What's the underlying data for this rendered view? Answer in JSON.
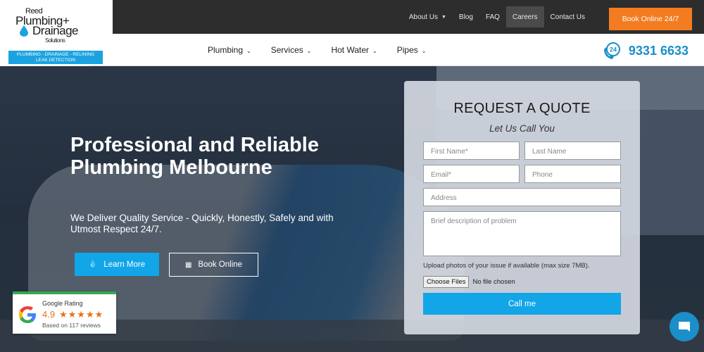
{
  "logo": {
    "line1": "Reed",
    "line2": "Plumbing+",
    "line3": "Drainage",
    "line4": "Solutions",
    "strip_line1": "PLUMBING - DRAINAGE - RELINING",
    "strip_line2": "LEAK DETECTION"
  },
  "topnav": {
    "items": [
      {
        "label": "About Us",
        "has_caret": true
      },
      {
        "label": "Blog"
      },
      {
        "label": "FAQ"
      },
      {
        "label": "Careers",
        "active": true
      },
      {
        "label": "Contact Us"
      }
    ],
    "book_button": "Book Online 24/7"
  },
  "mainnav": {
    "links": [
      "Plumbing",
      "Services",
      "Hot Water",
      "Pipes"
    ],
    "phone_badge": "24",
    "phone": "9331 6633"
  },
  "hero": {
    "title": "Professional and Reliable Plumbing Melbourne",
    "tagline": "We Deliver Quality Service - Quickly, Honestly, Safely and with Utmost Respect 24/7.",
    "learn_more": "Learn More",
    "book_online": "Book Online"
  },
  "google_rating": {
    "label": "Google Rating",
    "score": "4.9",
    "stars": "★★★★★",
    "reviews": "Based on 117 reviews"
  },
  "quote": {
    "title": "REQUEST A QUOTE",
    "subtitle": "Let Us Call You",
    "first_name": "First Name*",
    "last_name": "Last Name",
    "email": "Email*",
    "phone": "Phone",
    "address": "Address",
    "description": "Brief description of problem",
    "upload_note": "Upload photos of your issue if available (max size 7MB).",
    "choose_files": "Choose Files",
    "no_file": "No file chosen",
    "call_me": "Call me"
  },
  "colors": {
    "accent_blue": "#12a5e8",
    "book_orange": "#f47c20",
    "topbar": "#2d2d2d",
    "google_green": "#34a853",
    "star_orange": "#e7711b"
  }
}
